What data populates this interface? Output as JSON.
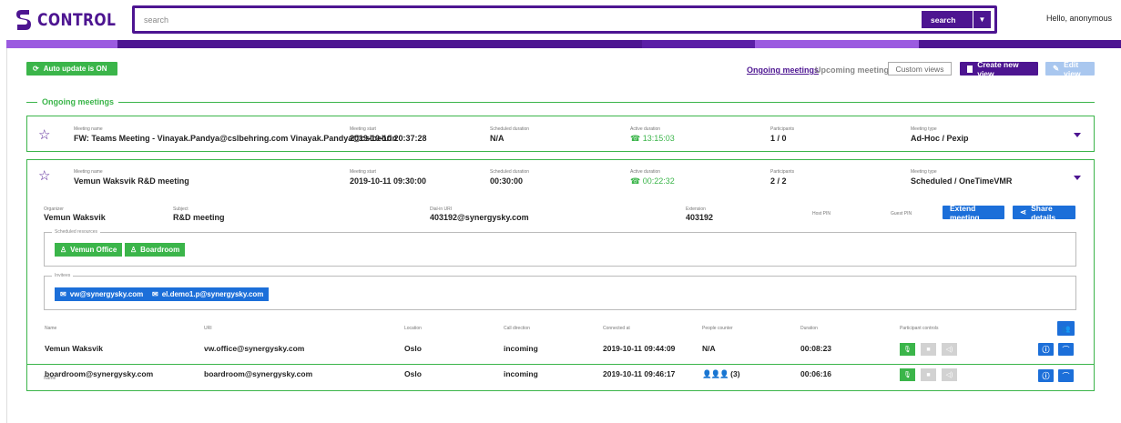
{
  "app": {
    "logo_text": "CONTROL",
    "greeting": "Hello, anonymous"
  },
  "search": {
    "placeholder": "search",
    "button_label": "search"
  },
  "colors": {
    "brand": "#4d1591",
    "accent_purple": "#9b5be0",
    "green": "#3bb54a",
    "blue": "#1c6fd9"
  },
  "toolbar": {
    "auto_update": "Auto update is ON",
    "tabs": [
      "Ongoing meetings",
      "Upcoming meetings"
    ],
    "custom_views": "Custom views",
    "create_view": "Create new view",
    "edit_view": "Edit view"
  },
  "section": {
    "title": "Ongoing meetings"
  },
  "meetings": [
    {
      "name_label": "Meeting name",
      "name": "FW: Teams Meeting - Vinayak.Pandya@cslbehring.com Vinayak.Pandya@cslbehrin",
      "start_label": "Meeting start",
      "start": "2019-10-10 20:37:28",
      "sched_label": "Scheduled duration",
      "sched": "N/A",
      "active_label": "Active duration",
      "active": "13:15:03",
      "part_label": "Participants",
      "part": "1 / 0",
      "type_label": "Meeting type",
      "type": "Ad-Hoc / Pexip"
    },
    {
      "name_label": "Meeting name",
      "name": "Vemun Waksvik R&D meeting",
      "start_label": "Meeting start",
      "start": "2019-10-11 09:30:00",
      "sched_label": "Scheduled duration",
      "sched": "00:30:00",
      "active_label": "Active duration",
      "active": "00:22:32",
      "part_label": "Participants",
      "part": "2 / 2",
      "type_label": "Meeting type",
      "type": "Scheduled / OneTimeVMR"
    }
  ],
  "details": {
    "organizer_label": "Organizer",
    "organizer": "Vemun Waksvik",
    "subject_label": "Subject",
    "subject": "R&D meeting",
    "dialin_label": "Dial-in URI",
    "dialin": "403192@synergysky.com",
    "extension_label": "Extension",
    "extension": "403192",
    "host_pin_label": "Host PIN",
    "guest_pin_label": "Guest PIN",
    "extend_button": "Extend meeting",
    "share_button": "Share details",
    "resources_legend": "Scheduled resources",
    "resources": [
      "Vemun Office",
      "Boardroom"
    ],
    "invitees_legend": "Invitees",
    "invitees": [
      "vw@synergysky.com",
      "el.demo1.p@synergysky.com"
    ]
  },
  "participants": {
    "headers": [
      "Name",
      "URI",
      "Location",
      "Call direction",
      "Connected at",
      "People counter",
      "Duration",
      "Participant controls"
    ],
    "rows": [
      {
        "name": "Vemun Waksvik",
        "uri": "vw.office@synergysky.com",
        "location": "Oslo",
        "direction": "incoming",
        "connected": "2019-10-11 09:44:09",
        "people": "N/A",
        "duration": "00:08:23"
      },
      {
        "name": "boardroom@synergysky.com",
        "uri": "boardroom@synergysky.com",
        "location": "Oslo",
        "direction": "incoming",
        "connected": "2019-10-11 09:46:17",
        "people": "(3)",
        "duration": "00:06:16"
      }
    ]
  }
}
